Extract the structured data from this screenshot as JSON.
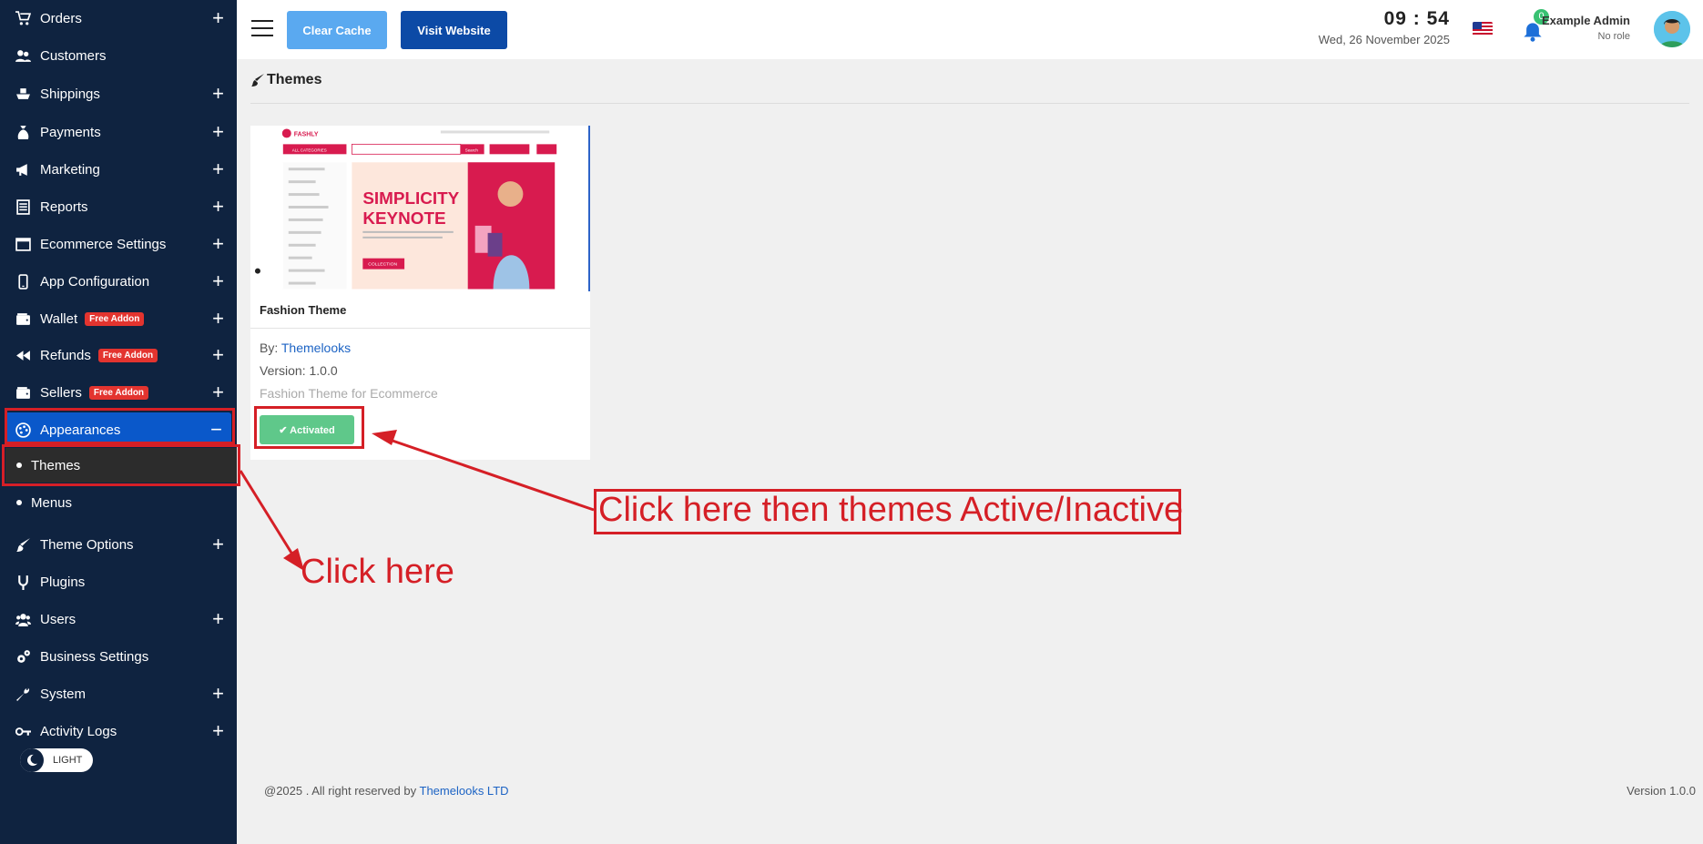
{
  "sidebar": {
    "items": [
      {
        "label": "Orders",
        "icon": "cart-icon",
        "expandable": true
      },
      {
        "label": "Customers",
        "icon": "customers-icon",
        "expandable": false
      },
      {
        "label": "Shippings",
        "icon": "ship-icon",
        "expandable": true
      },
      {
        "label": "Payments",
        "icon": "money-bag-icon",
        "expandable": true
      },
      {
        "label": "Marketing",
        "icon": "megaphone-icon",
        "expandable": true
      },
      {
        "label": "Reports",
        "icon": "report-icon",
        "expandable": true
      },
      {
        "label": "Ecommerce Settings",
        "icon": "window-icon",
        "expandable": true
      },
      {
        "label": "App Configuration",
        "icon": "mobile-icon",
        "expandable": true
      },
      {
        "label": "Wallet",
        "icon": "wallet-icon",
        "expandable": true,
        "badge": "Free Addon"
      },
      {
        "label": "Refunds",
        "icon": "backward-icon",
        "expandable": true,
        "badge": "Free Addon"
      },
      {
        "label": "Sellers",
        "icon": "wallet-icon",
        "expandable": true,
        "badge": "Free Addon"
      },
      {
        "label": "Appearances",
        "icon": "palette-icon",
        "expandable": true,
        "active": true
      },
      {
        "label": "Theme Options",
        "icon": "brush-icon",
        "expandable": true
      },
      {
        "label": "Plugins",
        "icon": "plug-icon",
        "expandable": false
      },
      {
        "label": "Users",
        "icon": "users-icon",
        "expandable": true
      },
      {
        "label": "Business Settings",
        "icon": "gears-icon",
        "expandable": false
      },
      {
        "label": "System",
        "icon": "wrench-icon",
        "expandable": true
      },
      {
        "label": "Activity Logs",
        "icon": "key-icon",
        "expandable": true
      }
    ],
    "appearances_sub": [
      {
        "label": "Themes",
        "current": true
      },
      {
        "label": "Menus",
        "current": false
      }
    ],
    "theme_toggle_label": "LIGHT"
  },
  "header": {
    "clear_cache": "Clear Cache",
    "visit_website": "Visit Website",
    "time": "09 : 54",
    "date": "Wed, 26 November 2025",
    "notification_count": "0",
    "user_name": "Example Admin",
    "user_role": "No role"
  },
  "page": {
    "title": "Themes"
  },
  "theme_card": {
    "name": "Fashion Theme",
    "by_label": "By:",
    "author": "Themelooks",
    "version": "Version: 1.0.0",
    "description": "Fashion Theme for Ecommerce",
    "status_button": "Activated",
    "preview": {
      "brand": "FASHLY",
      "category_button": "ALL CATEGORIES",
      "search_button": "Search",
      "hero_title_1": "SIMPLICITY",
      "hero_title_2": "KEYNOTE",
      "hero_cta": "COLLECTION"
    }
  },
  "footer": {
    "copyright_prefix": "@2025 . All right reserved by",
    "company": "Themelooks LTD",
    "version": "Version 1.0.0"
  },
  "annotations": {
    "click_here": "Click here",
    "click_themes": "Click here then themes Active/Inactive"
  },
  "colors": {
    "sidebar_bg": "#0f2340",
    "active_item": "#0a58ca",
    "annotation": "#d51f26",
    "activated_button": "#5fc88a"
  }
}
